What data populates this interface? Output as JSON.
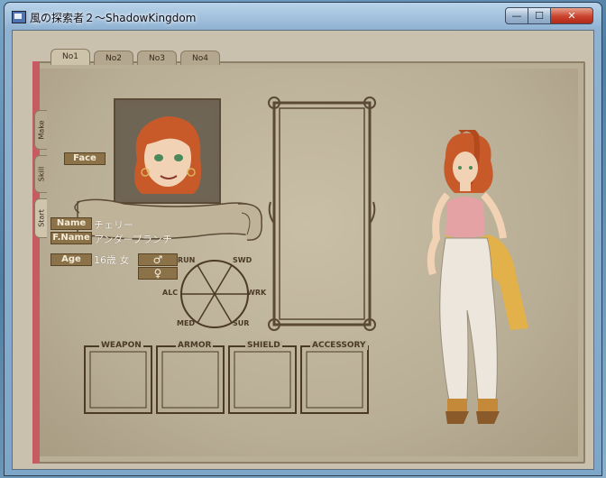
{
  "window": {
    "title": "風の探索者２～ShadowKingdom",
    "min_symbol": "—",
    "max_symbol": "☐",
    "close_symbol": "✕"
  },
  "top_tabs": [
    "No1",
    "No2",
    "No3",
    "No4"
  ],
  "side_tabs": [
    "Make",
    "Skill",
    "Start"
  ],
  "labels": {
    "face": "Face",
    "name": "Name",
    "family_name": "F.Name",
    "age": "Age"
  },
  "character": {
    "name": "チェリー",
    "family_name": "アンダーブランチ",
    "age_gender": "16歳 女"
  },
  "gender_buttons": {
    "male": "♂",
    "female": "♀"
  },
  "radar_labels": {
    "run": "RUN",
    "swd": "SWD",
    "alc": "ALC",
    "wrk": "WRK",
    "med": "MED",
    "sur": "SUR"
  },
  "equipment_slots": [
    "WEAPON",
    "ARMOR",
    "SHIELD",
    "ACCESSORY"
  ],
  "colors": {
    "hair": "#c85a2a",
    "skin": "#f2d2b4",
    "eyes": "#4a8a5a",
    "label_bg": "#8b7249",
    "spine": "#c65b62"
  },
  "icons": {
    "app": "app-icon",
    "scroll": "scroll-banner-icon"
  }
}
